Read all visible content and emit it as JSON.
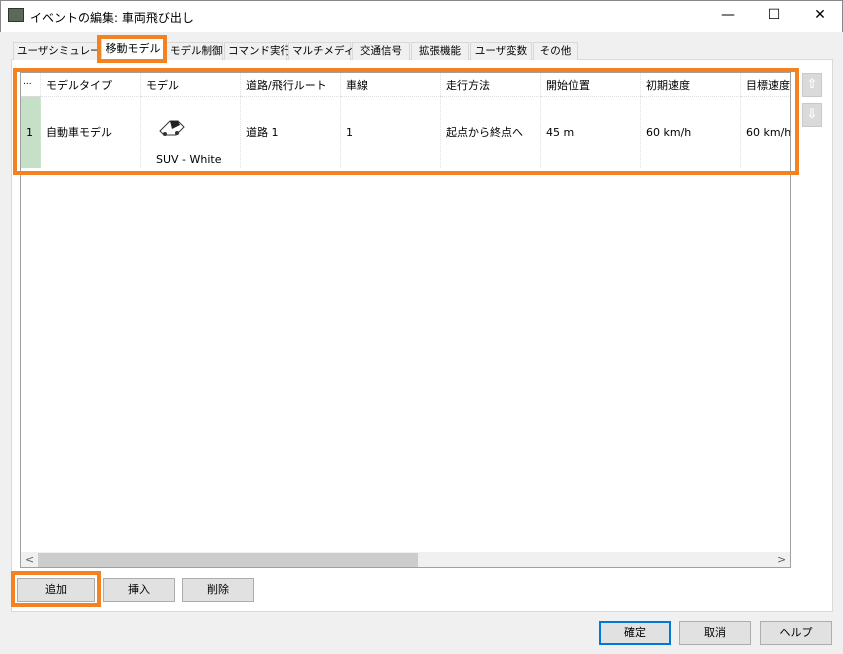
{
  "window": {
    "title": "イベントの編集: 車両飛び出し",
    "minimize": "—",
    "maximize": "☐",
    "close": "✕"
  },
  "tabs": [
    "ユーザシミュレーション",
    "移動モデル",
    "モデル制御",
    "コマンド実行",
    "マルチメディア",
    "交通信号",
    "拡張機能",
    "ユーザ変数",
    "その他"
  ],
  "table": {
    "row_header_label": "...",
    "columns": [
      "モデルタイプ",
      "モデル",
      "道路/飛行ルート",
      "車線",
      "走行方法",
      "開始位置",
      "初期速度",
      "目標速度"
    ],
    "rows": [
      {
        "index": "1",
        "cells": [
          "自動車モデル",
          "SUV - White",
          "道路 1",
          "1",
          "起点から終点へ",
          "45 m",
          "60 km/h",
          "60 km/h"
        ],
        "model_icon": "car-icon"
      }
    ]
  },
  "scroll": {
    "left": "<",
    "right": ">",
    "up": "⇧",
    "down": "⇩"
  },
  "buttons": {
    "add": "追加",
    "insert": "挿入",
    "delete": "削除",
    "ok": "確定",
    "cancel": "取消",
    "help": "ヘルプ"
  },
  "colors": {
    "highlight": "#f58220",
    "row_header": "#c6e0c8",
    "default_button": "#0078d7"
  }
}
